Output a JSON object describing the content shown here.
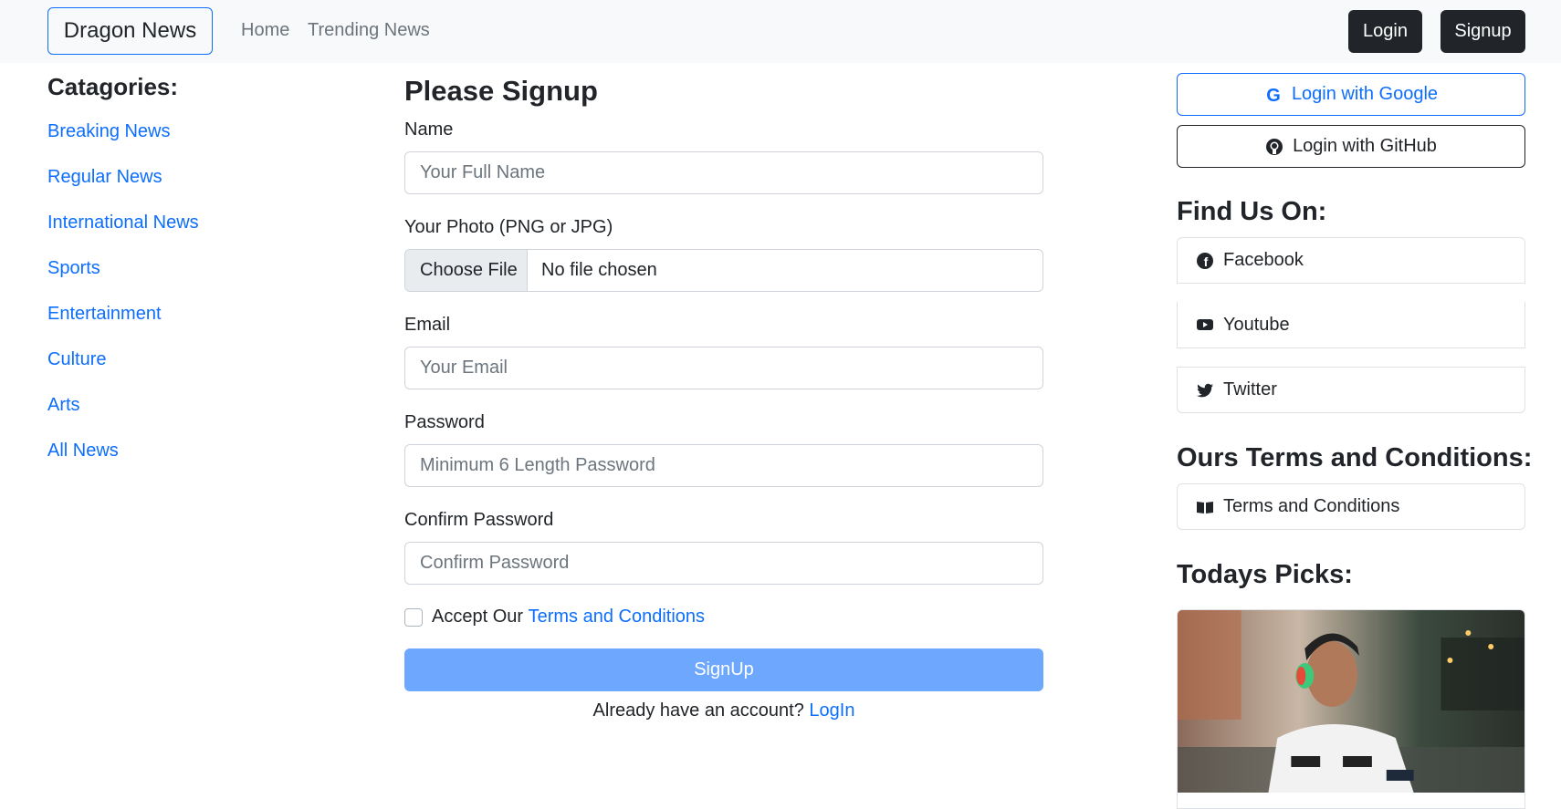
{
  "navbar": {
    "brand": "Dragon News",
    "links": [
      "Home",
      "Trending News"
    ],
    "login_label": "Login",
    "signup_label": "Signup"
  },
  "categories": {
    "title": "Catagories:",
    "items": [
      "Breaking News",
      "Regular News",
      "International News",
      "Sports",
      "Entertainment",
      "Culture",
      "Arts",
      "All News"
    ]
  },
  "form": {
    "title": "Please Signup",
    "name_label": "Name",
    "name_placeholder": "Your Full Name",
    "photo_label": "Your Photo (PNG or JPG)",
    "file_button": "Choose File",
    "file_status": "No file chosen",
    "email_label": "Email",
    "email_placeholder": "Your Email",
    "password_label": "Password",
    "password_placeholder": "Minimum 6 Length Password",
    "confirm_label": "Confirm Password",
    "confirm_placeholder": "Confirm Password",
    "accept_text": "Accept Our",
    "terms_link": "Terms and Conditions",
    "submit_label": "SignUp",
    "already_text": "Already have an account?",
    "login_link": "LogIn"
  },
  "right": {
    "google_label": "Login with Google",
    "github_label": "Login with GitHub",
    "find_title": "Find Us On:",
    "social": [
      {
        "label": "Facebook",
        "icon": "facebook-icon"
      },
      {
        "label": "Youtube",
        "icon": "youtube-icon"
      },
      {
        "label": "Twitter",
        "icon": "twitter-icon"
      }
    ],
    "terms_title": "Ours Terms and Conditions:",
    "terms_item": "Terms and Conditions",
    "picks_title": "Todays Picks:"
  },
  "colors": {
    "primary": "#0d6efd",
    "dark": "#212529",
    "submit_disabled": "#6ea8fe",
    "navbar_bg": "#f8f9fa"
  }
}
